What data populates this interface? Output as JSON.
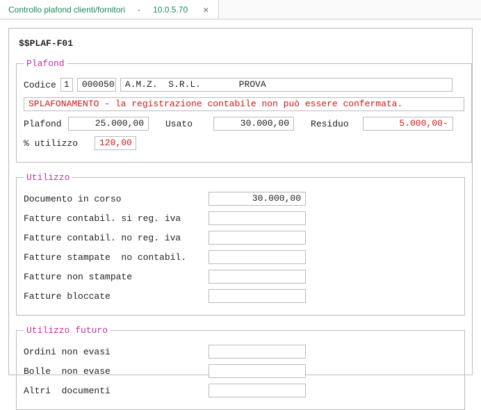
{
  "tab": {
    "title": "Controllo plafond clienti/fornitori",
    "sep": "-",
    "version": "10.0.5.70",
    "close": "×"
  },
  "screen_id": "$$PLAF-F01",
  "plafond": {
    "legend": "Plafond",
    "codice_label": "Codice",
    "codice_type": "1",
    "codice_num": "000050",
    "codice_name": "A.M.Z.  S.R.L.       PROVA",
    "warning": "SPLAFONAMENTO - la registrazione contabile non può essere confermata.",
    "plafond_label": "Plafond",
    "plafond_value": "25.000,00",
    "usato_label": "Usato",
    "usato_value": "30.000,00",
    "residuo_label": "Residuo",
    "residuo_value": "5.000,00-",
    "pct_label": "% utilizzo",
    "pct_value": "120,00"
  },
  "utilizzo": {
    "legend": "Utilizzo",
    "rows": [
      {
        "label": "Documento in corso",
        "value": "30.000,00"
      },
      {
        "label": "Fatture contabil. si reg. iva",
        "value": ""
      },
      {
        "label": "Fatture contabil. no reg. iva",
        "value": ""
      },
      {
        "label": "Fatture stampate  no contabil.",
        "value": ""
      },
      {
        "label": "Fatture non stampate",
        "value": ""
      },
      {
        "label": "Fatture bloccate",
        "value": ""
      }
    ]
  },
  "futuro": {
    "legend": "Utilizzo futuro",
    "rows": [
      {
        "label": "Ordini non evasi",
        "value": ""
      },
      {
        "label": "Bolle  non evase",
        "value": ""
      },
      {
        "label": "Altri  documenti",
        "value": ""
      }
    ]
  }
}
